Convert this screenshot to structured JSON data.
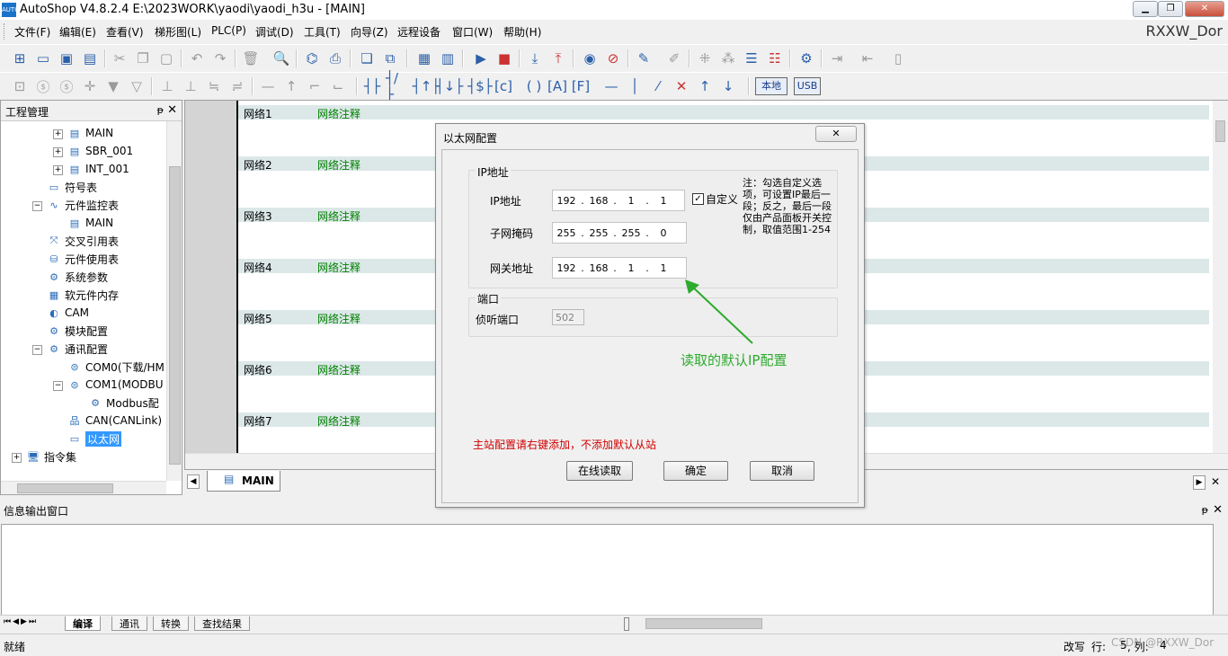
{
  "window": {
    "title": "AutoShop V4.8.2.4  E:\\2023WORK\\yaodi\\yaodi_h3u - [MAIN]",
    "app_icon_text": "AUTO",
    "minimize": "▁",
    "restore": "❐",
    "close": "✕"
  },
  "menu": {
    "items": [
      "文件(F)",
      "编辑(E)",
      "查看(V)",
      "梯形图(L)",
      "PLC(P)",
      "调试(D)",
      "工具(T)",
      "向导(Z)",
      "远程设备",
      "窗口(W)",
      "帮助(H)"
    ],
    "right_text": "RXXW_Dor"
  },
  "toolbar2": {
    "local_label": "本地",
    "usb_label": "USB"
  },
  "project_panel": {
    "title": "工程管理",
    "pin": "ᵽ",
    "close": "✕",
    "items": [
      {
        "label": "MAIN",
        "icon": "ladder-doc-icon"
      },
      {
        "label": "SBR_001",
        "icon": "ladder-doc-icon"
      },
      {
        "label": "INT_001",
        "icon": "ladder-doc-icon"
      },
      {
        "label": "符号表",
        "icon": "symbol-table-icon"
      },
      {
        "label": "元件监控表",
        "icon": "monitor-icon"
      },
      {
        "label": "MAIN",
        "icon": "table-icon"
      },
      {
        "label": "交叉引用表",
        "icon": "cross-ref-icon"
      },
      {
        "label": "元件使用表",
        "icon": "usage-icon"
      },
      {
        "label": "系统参数",
        "icon": "system-param-icon"
      },
      {
        "label": "软元件内存",
        "icon": "memory-icon"
      },
      {
        "label": "CAM",
        "icon": "cam-icon"
      },
      {
        "label": "模块配置",
        "icon": "module-icon"
      },
      {
        "label": "通讯配置",
        "icon": "comm-icon"
      },
      {
        "label": "COM0(下载/HM",
        "icon": "serial-port-icon"
      },
      {
        "label": "COM1(MODBU",
        "icon": "serial-port-icon"
      },
      {
        "label": "Modbus配",
        "icon": "gear-icon"
      },
      {
        "label": "CAN(CANLink)",
        "icon": "network-icon"
      },
      {
        "label": "以太网",
        "icon": "ethernet-icon"
      },
      {
        "label": "指令集",
        "icon": "computer-icon"
      }
    ]
  },
  "editor": {
    "networks": [
      {
        "label": "网络1",
        "comment": "网络注释"
      },
      {
        "label": "网络2",
        "comment": "网络注释"
      },
      {
        "label": "网络3",
        "comment": "网络注释"
      },
      {
        "label": "网络4",
        "comment": "网络注释"
      },
      {
        "label": "网络5",
        "comment": "网络注释"
      },
      {
        "label": "网络6",
        "comment": "网络注释"
      },
      {
        "label": "网络7",
        "comment": "网络注释"
      }
    ],
    "tab_label": "MAIN"
  },
  "output": {
    "title": "信息输出窗口",
    "tabs": [
      "编译",
      "通讯",
      "转换",
      "查找结果"
    ]
  },
  "status": {
    "left": "就绪",
    "mode": "改写",
    "row_label": "行:",
    "row": "5",
    "col_label": ", 列:",
    "col": "4",
    "watermark": "CSDN @RXXW_Dor"
  },
  "dialog": {
    "title": "以太网配置",
    "close": "✕",
    "ip_group": "IP地址",
    "ip_label": "IP地址",
    "ip": [
      "192",
      "168",
      "1",
      "1"
    ],
    "custom_label": "自定义",
    "custom_checked": "✓",
    "subnet_label": "子网掩码",
    "subnet": [
      "255",
      "255",
      "255",
      "0"
    ],
    "gateway_label": "网关地址",
    "gateway": [
      "192",
      "168",
      "1",
      "1"
    ],
    "note": "注：勾选自定义选项，可设置IP最后一段；反之，最后一段仅由产品面板开关控制，取值范围1-254",
    "port_group": "端口",
    "port_label": "侦听端口",
    "port_value": "502",
    "annotation": "读取的默认IP配置",
    "warning": "主站配置请右键添加，不添加默认从站",
    "btn_read": "在线读取",
    "btn_ok": "确定",
    "btn_cancel": "取消"
  },
  "colors": {
    "comment_green": "#008000",
    "annotation_green": "#2eaa2e",
    "warning_red": "#d00000",
    "selection_blue": "#3399ff",
    "network_row": "#dce8e8"
  }
}
